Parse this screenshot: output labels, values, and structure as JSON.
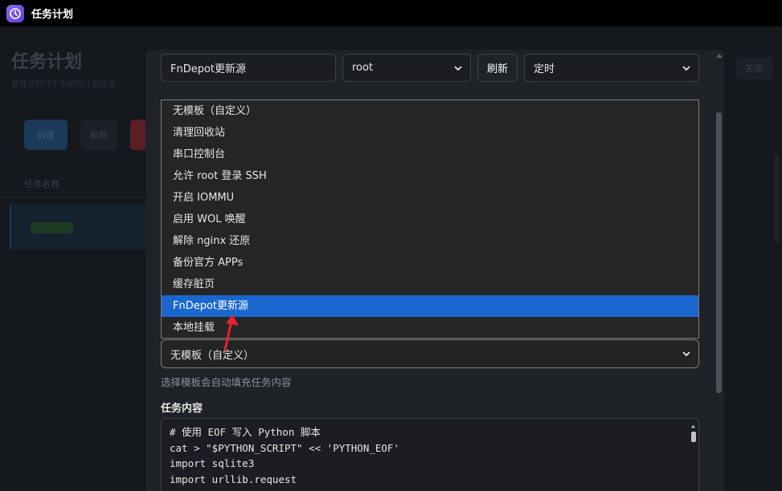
{
  "app": {
    "title": "任务计划",
    "icon": "clock-icon"
  },
  "background": {
    "page_title": "任务计划",
    "page_subtitle": "管理您的飞牛系统的计划任务",
    "new_button": "创建",
    "refresh_button": "刷新",
    "table_header": "任务名称",
    "right_button": "关闭"
  },
  "modal": {
    "task_name_value": "FnDepot更新源",
    "user_select_value": "root",
    "refresh_label": "刷新",
    "type_select_value": "定时",
    "template_options": [
      "无模板（自定义）",
      "清理回收站",
      "串口控制台",
      "允许 root 登录 SSH",
      "开启 IOMMU",
      "启用 WOL 唤醒",
      "解除 nginx 还原",
      "备份官方 APPs",
      "缓存脏页",
      "FnDepot更新源",
      "本地挂载"
    ],
    "template_highlighted_index": 9,
    "template_select_value": "无模板（自定义）",
    "template_hint": "选择模板会自动填充任务内容",
    "content_label": "任务内容",
    "code_lines": [
      "# 使用 EOF 写入 Python 脚本",
      "cat > \"$PYTHON_SCRIPT\" << 'PYTHON_EOF'",
      "import sqlite3",
      "import urllib.request"
    ]
  },
  "colors": {
    "highlight": "#1a68cf",
    "arrow": "#e5222f",
    "app_icon": "#6d4fe0"
  }
}
